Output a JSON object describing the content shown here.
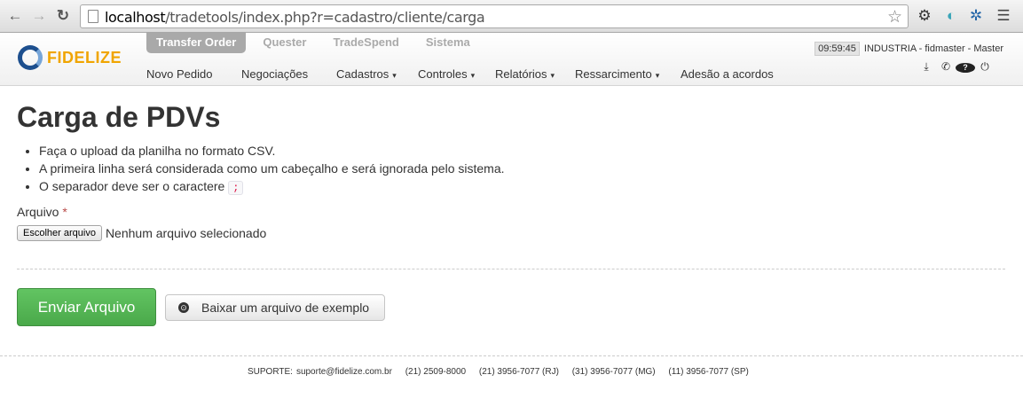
{
  "browser": {
    "url_host": "localhost",
    "url_path": "/tradetools/index.php?r=cadastro/cliente/carga",
    "back_icon": "arrow-left-icon",
    "forward_icon": "arrow-right-icon",
    "reload_icon": "reload-icon",
    "star_icon": "star-icon"
  },
  "app": {
    "logo_text": "FIDELIZE",
    "brand_colors": {
      "orange": "#f0a500",
      "blue": "#1d4f8e"
    },
    "top_tabs": [
      {
        "label": "Transfer Order",
        "active": true
      },
      {
        "label": "Quester",
        "active": false
      },
      {
        "label": "TradeSpend",
        "active": false
      },
      {
        "label": "Sistema",
        "active": false
      }
    ],
    "main_nav": [
      {
        "label": "Novo Pedido",
        "dropdown": false
      },
      {
        "label": "Negociações",
        "dropdown": false
      },
      {
        "label": "Cadastros",
        "dropdown": true
      },
      {
        "label": "Controles",
        "dropdown": true
      },
      {
        "label": "Relatórios",
        "dropdown": true
      },
      {
        "label": "Ressarcimento",
        "dropdown": true
      },
      {
        "label": "Adesão a acordos",
        "dropdown": false
      }
    ],
    "caret": "▾",
    "clock": "09:59:45",
    "session_user": "INDUSTRIA - fidmaster - Master"
  },
  "page": {
    "title": "Carga de PDVs",
    "rules": [
      "Faça o upload da planilha no formato CSV.",
      "A primeira linha será considerada como um cabeçalho e será ignorada pelo sistema.",
      "O separador deve ser o caractere"
    ],
    "separator_char": ";",
    "field_label": "Arquivo",
    "required_mark": "*",
    "file_button": "Escolher arquivo",
    "file_status": "Nenhum arquivo selecionado",
    "submit_button": "Enviar Arquivo",
    "example_button": "Baixar um arquivo de exemplo",
    "primary_color": "#5cb85c"
  },
  "footer": {
    "support_label": "SUPORTE:",
    "email": "suporte@fidelize.com.br",
    "phones": [
      "(21) 2509-8000",
      "(21) 3956-7077 (RJ)",
      "(31) 3956-7077 (MG)",
      "(11) 3956-7077 (SP)"
    ]
  }
}
